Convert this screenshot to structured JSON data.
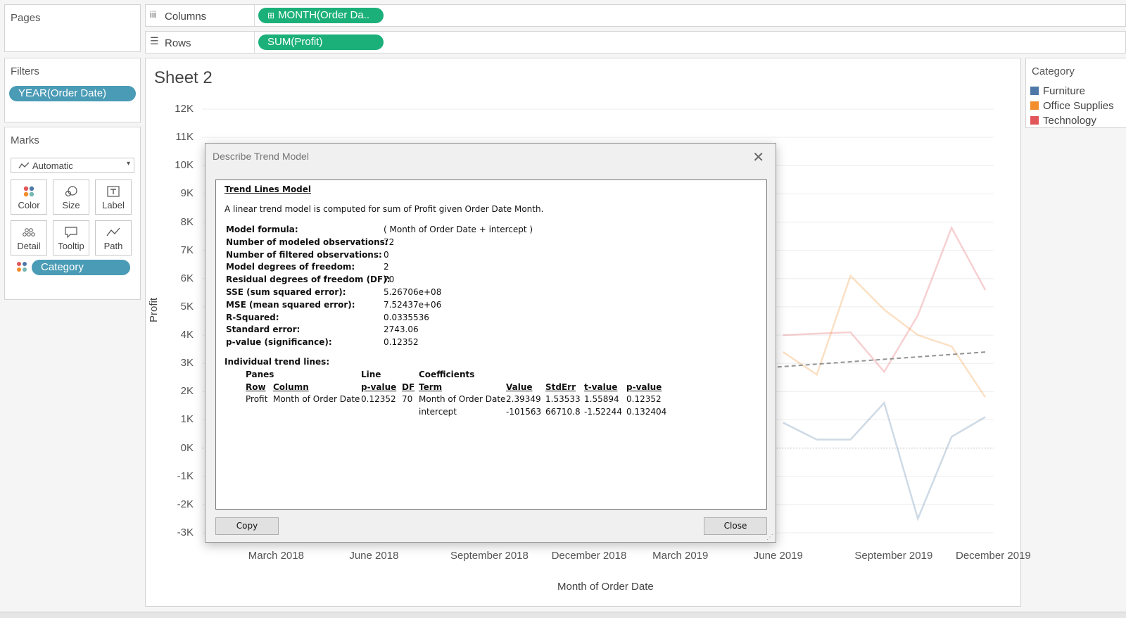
{
  "pages": {
    "title": "Pages"
  },
  "shelves": {
    "columns_label": "Columns",
    "columns_pill": "MONTH(Order Da..",
    "rows_label": "Rows",
    "rows_pill": "SUM(Profit)"
  },
  "filters": {
    "title": "Filters",
    "pill": "YEAR(Order Date)"
  },
  "marks": {
    "title": "Marks",
    "type": "Automatic",
    "buttons": [
      "Color",
      "Size",
      "Label",
      "Detail",
      "Tooltip",
      "Path"
    ],
    "category_pill": "Category"
  },
  "legend": {
    "title": "Category",
    "items": [
      {
        "label": "Furniture",
        "color": "#4e79a7"
      },
      {
        "label": "Office Supplies",
        "color": "#f28e2b"
      },
      {
        "label": "Technology",
        "color": "#e15759"
      }
    ]
  },
  "sheet": {
    "title": "Sheet 2"
  },
  "chart_data": {
    "type": "line",
    "ylabel": "Profit",
    "xlabel": "Month of Order Date",
    "y_ticks": [
      "12K",
      "11K",
      "10K",
      "9K",
      "8K",
      "7K",
      "6K",
      "5K",
      "4K",
      "3K",
      "2K",
      "1K",
      "0K",
      "-1K",
      "-2K",
      "-3K"
    ],
    "ylim": [
      -3000,
      12000
    ],
    "x_ticks": [
      "March 2018",
      "June 2018",
      "September 2018",
      "December 2018",
      "March 2019",
      "June 2019",
      "September 2019",
      "December 2019"
    ],
    "series": [
      {
        "color": "#e15759",
        "x": [
          "2019-06",
          "2019-08",
          "2019-09",
          "2019-10",
          "2019-11",
          "2019-12"
        ],
        "values": [
          4000,
          4100,
          2700,
          4700,
          7800,
          5600
        ]
      },
      {
        "color": "#f28e2b",
        "x": [
          "2019-06",
          "2019-07",
          "2019-08",
          "2019-09",
          "2019-10",
          "2019-11",
          "2019-12"
        ],
        "values": [
          3400,
          2600,
          6100,
          4900,
          4000,
          3600,
          1800
        ]
      },
      {
        "color": "#4e79a7",
        "x": [
          "2019-06",
          "2019-07",
          "2019-08",
          "2019-09",
          "2019-10",
          "2019-11",
          "2019-12"
        ],
        "values": [
          900,
          300,
          300,
          1600,
          -2500,
          400,
          1100
        ]
      },
      {
        "name": "trend",
        "color": "#888888",
        "x": [
          "2019-05",
          "2019-12"
        ],
        "values": [
          2800,
          3400
        ]
      }
    ]
  },
  "dialog": {
    "title": "Describe Trend Model",
    "heading": "Trend Lines Model",
    "intro": "A linear trend model is computed for sum of Profit given Order Date Month.",
    "stats": [
      {
        "label": "Model formula:",
        "value": "( Month of Order Date + intercept )"
      },
      {
        "label": "Number of modeled observations:",
        "value": "72"
      },
      {
        "label": "Number of filtered observations:",
        "value": "0"
      },
      {
        "label": "Model degrees of freedom:",
        "value": "2"
      },
      {
        "label": "Residual degrees of freedom (DF):",
        "value": "70"
      },
      {
        "label": "SSE (sum squared error):",
        "value": "5.26706e+08"
      },
      {
        "label": "MSE (mean squared error):",
        "value": "7.52437e+06"
      },
      {
        "label": "R-Squared:",
        "value": "0.0335536"
      },
      {
        "label": "Standard error:",
        "value": "2743.06"
      },
      {
        "label": "p-value (significance):",
        "value": "0.12352"
      }
    ],
    "individual_title": "Individual trend lines:",
    "group_headers": {
      "panes": "Panes",
      "line": "Line",
      "coefficients": "Coefficients"
    },
    "col_headers": {
      "row": "Row",
      "column": "Column",
      "pvalue": "p-value",
      "df": "DF",
      "term": "Term",
      "value": "Value",
      "stderr": "StdErr",
      "tvalue": "t-value",
      "pval": "p-value"
    },
    "row1": {
      "row": "Profit",
      "column": "Month of Order Date",
      "pvalue": "0.12352",
      "df": "70",
      "term": "Month of Order Date",
      "value": "2.39349",
      "stderr": "1.53533",
      "tvalue": "1.55894",
      "pval": "0.12352"
    },
    "row2": {
      "term": "intercept",
      "value": "-101563",
      "stderr": "66710.8",
      "tvalue": "-1.52244",
      "pval": "0.132404"
    },
    "copy_label": "Copy",
    "close_label": "Close"
  }
}
